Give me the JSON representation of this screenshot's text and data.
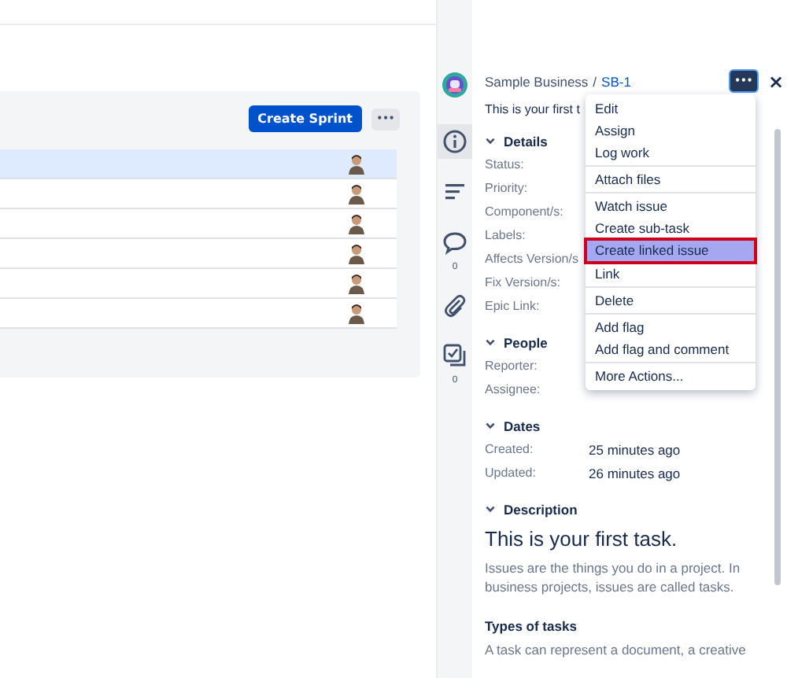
{
  "backlog": {
    "create_button": "Create Sprint",
    "more_button": "•••",
    "rows": [
      {
        "selected": true
      },
      {
        "selected": false
      },
      {
        "selected": false
      },
      {
        "selected": false
      },
      {
        "selected": false
      },
      {
        "selected": false
      }
    ]
  },
  "issue_panel": {
    "sidebar": [
      {
        "kind": "project",
        "selected": false
      },
      {
        "kind": "info",
        "selected": true
      },
      {
        "kind": "activity",
        "selected": false
      },
      {
        "kind": "comments",
        "selected": false,
        "count": "0"
      },
      {
        "kind": "attachments",
        "selected": false
      },
      {
        "kind": "subtasks",
        "selected": false,
        "count": "0"
      }
    ],
    "breadcrumb": {
      "project": "Sample Business",
      "separator": "/",
      "key": "SB-1"
    },
    "more_button": "•••",
    "close_button": "×",
    "summary": "This is your first t",
    "sections": [
      {
        "title": "Details",
        "fields": [
          {
            "label": "Status:"
          },
          {
            "label": "Priority:"
          },
          {
            "label": "Component/s:"
          },
          {
            "label": "Labels:"
          },
          {
            "label": "Affects Version/s"
          },
          {
            "label": "Fix Version/s:"
          },
          {
            "label": "Epic Link:"
          }
        ]
      },
      {
        "title": "People",
        "fields": [
          {
            "label": "Reporter:"
          },
          {
            "label": "Assignee:"
          }
        ]
      },
      {
        "title": "Dates",
        "fields": [
          {
            "label": "Created:",
            "value": "25 minutes ago"
          },
          {
            "label": "Updated:",
            "value": "26 minutes ago"
          }
        ]
      }
    ],
    "description": {
      "title": "Description",
      "heading": "This is your first task.",
      "text": "Issues are the things you do in a project. In business projects, issues are called tasks.",
      "subheading": "Types of tasks",
      "text_2": "A task can represent a document, a creative"
    }
  },
  "actions_menu": {
    "groups": [
      {
        "items": [
          {
            "label": "Edit",
            "selected": false
          },
          {
            "label": "Assign",
            "selected": false
          },
          {
            "label": "Log work",
            "selected": false
          }
        ]
      },
      {
        "items": [
          {
            "label": "Attach files",
            "selected": false
          }
        ]
      },
      {
        "items": [
          {
            "label": "Watch issue",
            "selected": false
          },
          {
            "label": "Create sub-task",
            "selected": false
          },
          {
            "label": "Create linked issue",
            "selected": true
          },
          {
            "label": "Link",
            "selected": false
          }
        ]
      },
      {
        "items": [
          {
            "label": "Delete",
            "selected": false
          }
        ]
      },
      {
        "items": [
          {
            "label": "Add flag",
            "selected": false
          },
          {
            "label": "Add flag and comment",
            "selected": false
          }
        ]
      },
      {
        "items": [
          {
            "label": "More Actions...",
            "selected": false
          }
        ]
      }
    ]
  }
}
